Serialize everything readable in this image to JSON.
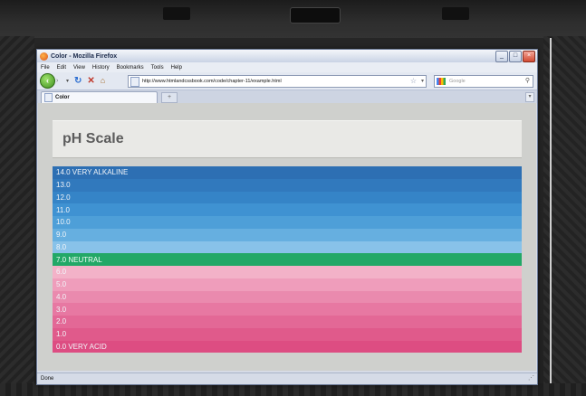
{
  "window": {
    "title": "Color - Mozilla Firefox"
  },
  "menu": [
    "File",
    "Edit",
    "View",
    "History",
    "Bookmarks",
    "Tools",
    "Help"
  ],
  "nav": {
    "url": "http://www.htmlandcssbook.com/code/chapter-11/example.html",
    "search_placeholder": "Google"
  },
  "tabs": [
    {
      "label": "Color"
    }
  ],
  "page": {
    "title": "pH Scale",
    "rows": [
      {
        "label": "14.0 VERY ALKALINE",
        "color": "#2d6fb3"
      },
      {
        "label": "13.0",
        "color": "#3179bd"
      },
      {
        "label": "12.0",
        "color": "#3584c7"
      },
      {
        "label": "11.0",
        "color": "#3f92d2"
      },
      {
        "label": "10.0",
        "color": "#4e9fd8"
      },
      {
        "label": "9.0",
        "color": "#66afe0"
      },
      {
        "label": "8.0",
        "color": "#88c2e9"
      },
      {
        "label": "7.0 NEUTRAL",
        "color": "#22a867"
      },
      {
        "label": "6.0",
        "color": "#f3b2c8"
      },
      {
        "label": "5.0",
        "color": "#ef9dbb"
      },
      {
        "label": "4.0",
        "color": "#ea8aae"
      },
      {
        "label": "3.0",
        "color": "#e778a2"
      },
      {
        "label": "2.0",
        "color": "#e36896"
      },
      {
        "label": "1.0",
        "color": "#e05a8b"
      },
      {
        "label": "0.0 VERY ACID",
        "color": "#dd4d82"
      }
    ]
  },
  "status": {
    "text": "Done"
  }
}
